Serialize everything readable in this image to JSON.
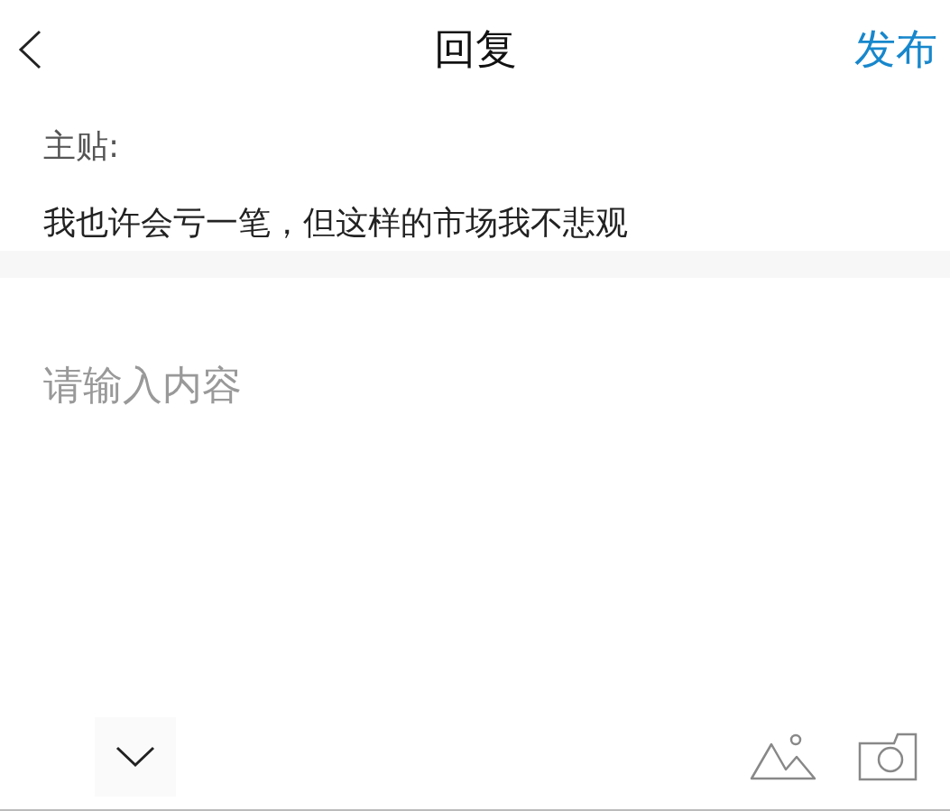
{
  "header": {
    "title": "回复",
    "action": "发布"
  },
  "quote": {
    "label": "主贴:",
    "text": "我也许会亏一笔，但这样的市场我不悲观"
  },
  "reply": {
    "placeholder": "请输入内容"
  }
}
